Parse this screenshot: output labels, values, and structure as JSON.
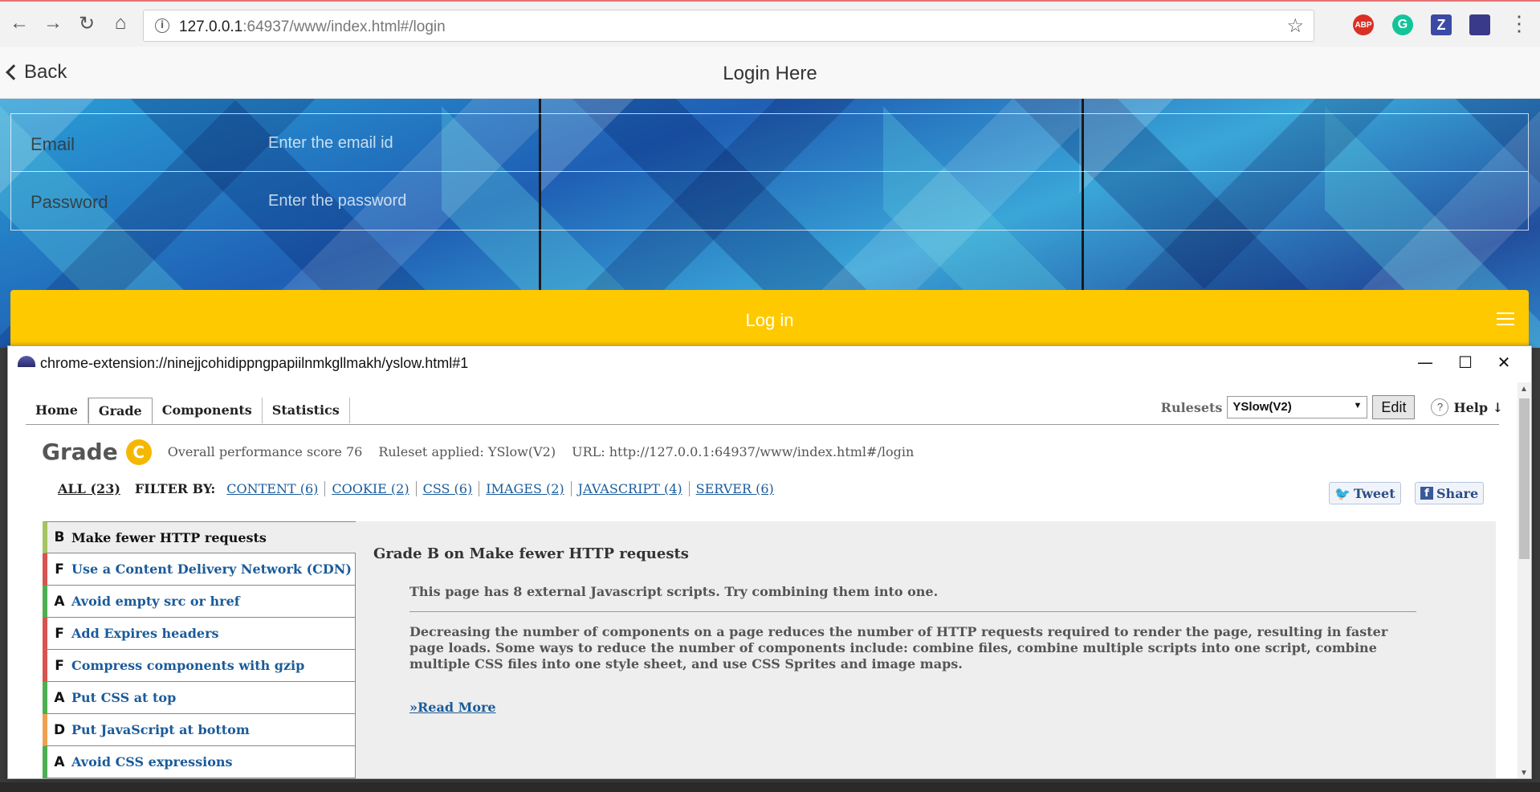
{
  "browser": {
    "url_host": "127.0.0.1",
    "url_rest": ":64937/www/index.html#/login",
    "icons": [
      "back-arrow-icon",
      "forward-arrow-icon",
      "reload-icon",
      "home-icon",
      "info-icon",
      "star-icon",
      "menu-dots-icon"
    ],
    "extensions": [
      {
        "name": "abp",
        "label": "ABP",
        "color": "#d93025"
      },
      {
        "name": "grammarly",
        "label": "G",
        "color": "#15c39a"
      },
      {
        "name": "zotero",
        "label": "Z",
        "color": "#3b4aa5"
      },
      {
        "name": "yslow",
        "label": "",
        "color": "#3a3a8a"
      }
    ]
  },
  "app": {
    "back_label": "Back",
    "title": "Login Here",
    "email_label": "Email",
    "email_placeholder": "Enter the email id",
    "password_label": "Password",
    "password_placeholder": "Enter the password",
    "login_label": "Log in"
  },
  "yslow": {
    "window_title": "chrome-extension://ninejjcohidippngpapiilnmkgllmakh/yslow.html#1",
    "tabs": [
      "Home",
      "Grade",
      "Components",
      "Statistics"
    ],
    "active_tab": "Grade",
    "rulesets_label": "Rulesets",
    "ruleset_value": "YSlow(V2)",
    "edit_label": "Edit",
    "help_q": "?",
    "help_label": "Help ↓",
    "grade_label": "Grade",
    "grade_letter": "C",
    "score_text": "Overall performance score 76",
    "ruleset_applied": "Ruleset applied: YSlow(V2)",
    "url_text": "URL: http://127.0.0.1:64937/www/index.html#/login",
    "filter_all": "ALL (23)",
    "filter_by": "FILTER BY:",
    "filters": [
      "CONTENT (6)",
      "COOKIE (2)",
      "CSS (6)",
      "IMAGES (2)",
      "JAVASCRIPT (4)",
      "SERVER (6)"
    ],
    "tweet_label": "Tweet",
    "share_label": "Share",
    "rules": [
      {
        "grade": "B",
        "label": "Make fewer HTTP requests",
        "color": "#a5c461"
      },
      {
        "grade": "F",
        "label": "Use a Content Delivery Network (CDN)",
        "color": "#d9534f"
      },
      {
        "grade": "A",
        "label": "Avoid empty src or href",
        "color": "#4caf50"
      },
      {
        "grade": "F",
        "label": "Add Expires headers",
        "color": "#d9534f"
      },
      {
        "grade": "F",
        "label": "Compress components with gzip",
        "color": "#d9534f"
      },
      {
        "grade": "A",
        "label": "Put CSS at top",
        "color": "#4caf50"
      },
      {
        "grade": "D",
        "label": "Put JavaScript at bottom",
        "color": "#f0a050"
      },
      {
        "grade": "A",
        "label": "Avoid CSS expressions",
        "color": "#4caf50"
      }
    ],
    "detail_title": "Grade B on Make fewer HTTP requests",
    "detail_summary": "This page has 8 external Javascript scripts. Try combining them into one.",
    "detail_body": "Decreasing the number of components on a page reduces the number of HTTP requests required to render the page, resulting in faster page loads. Some ways to reduce the number of components include: combine files, combine multiple scripts into one script, combine multiple CSS files into one style sheet, and use CSS Sprites and image maps.",
    "read_more": "»Read More"
  }
}
